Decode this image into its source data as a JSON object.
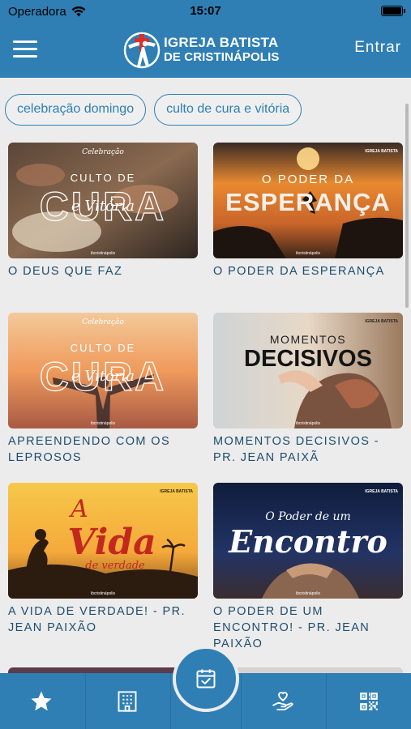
{
  "status_bar": {
    "carrier": "Operadora",
    "time": "15:07"
  },
  "header": {
    "logo_line1": "IGREJA BATISTA",
    "logo_line2": "DE CRISTINÁPOLIS",
    "login_label": "Entrar"
  },
  "tags": [
    "celebração domingo",
    "culto de cura e vitória"
  ],
  "cards": [
    {
      "title": "O DEUS QUE FAZ",
      "art": {
        "line1": "CULTO DE",
        "line2": "CURA",
        "line3": "e Vitória",
        "top": "Celebração",
        "footer": "ibcristinápolis"
      }
    },
    {
      "title": "O PODER DA ESPERANÇA",
      "art": {
        "line1": "O PODER DA",
        "line2": "ESPERANÇA",
        "brand": "IGREJA BATISTA",
        "footer": "ibcristinápolis"
      }
    },
    {
      "title": "APREENDENDO COM OS LEPROSOS",
      "art": {
        "line1": "CULTO DE",
        "line2": "CURA",
        "line3": "e Vitória",
        "top": "Celebração",
        "footer": "ibcristinápolis"
      }
    },
    {
      "title": "MOMENTOS DECISIVOS - PR. JEAN PAIXÃ",
      "art": {
        "line1": "MOMENTOS",
        "line2": "DECISIVOS",
        "brand": "IGREJA BATISTA",
        "footer": "ibcristinápolis"
      }
    },
    {
      "title": "A VIDA DE VERDADE! - PR. JEAN PAIXÃO",
      "art": {
        "line1": "A",
        "line2": "Vida",
        "line3": "de verdade",
        "brand": "IGREJA BATISTA",
        "footer": "ibcristinápolis"
      }
    },
    {
      "title": "O PODER DE UM ENCONTRO! - PR. JEAN PAIXÃO",
      "art": {
        "line1": "O Poder de um",
        "line2": "Encontro",
        "brand": "IGREJA BATISTA",
        "footer": "ibcristinápolis"
      }
    }
  ],
  "nav": {
    "favorites_icon": "star-icon",
    "church_icon": "building-icon",
    "calendar_icon": "calendar-check-icon",
    "donate_icon": "hand-heart-icon",
    "qr_icon": "qr-code-icon"
  },
  "colors": {
    "primary": "#2f7fb5",
    "title_text": "#1e4d6e",
    "background": "#ececec"
  }
}
